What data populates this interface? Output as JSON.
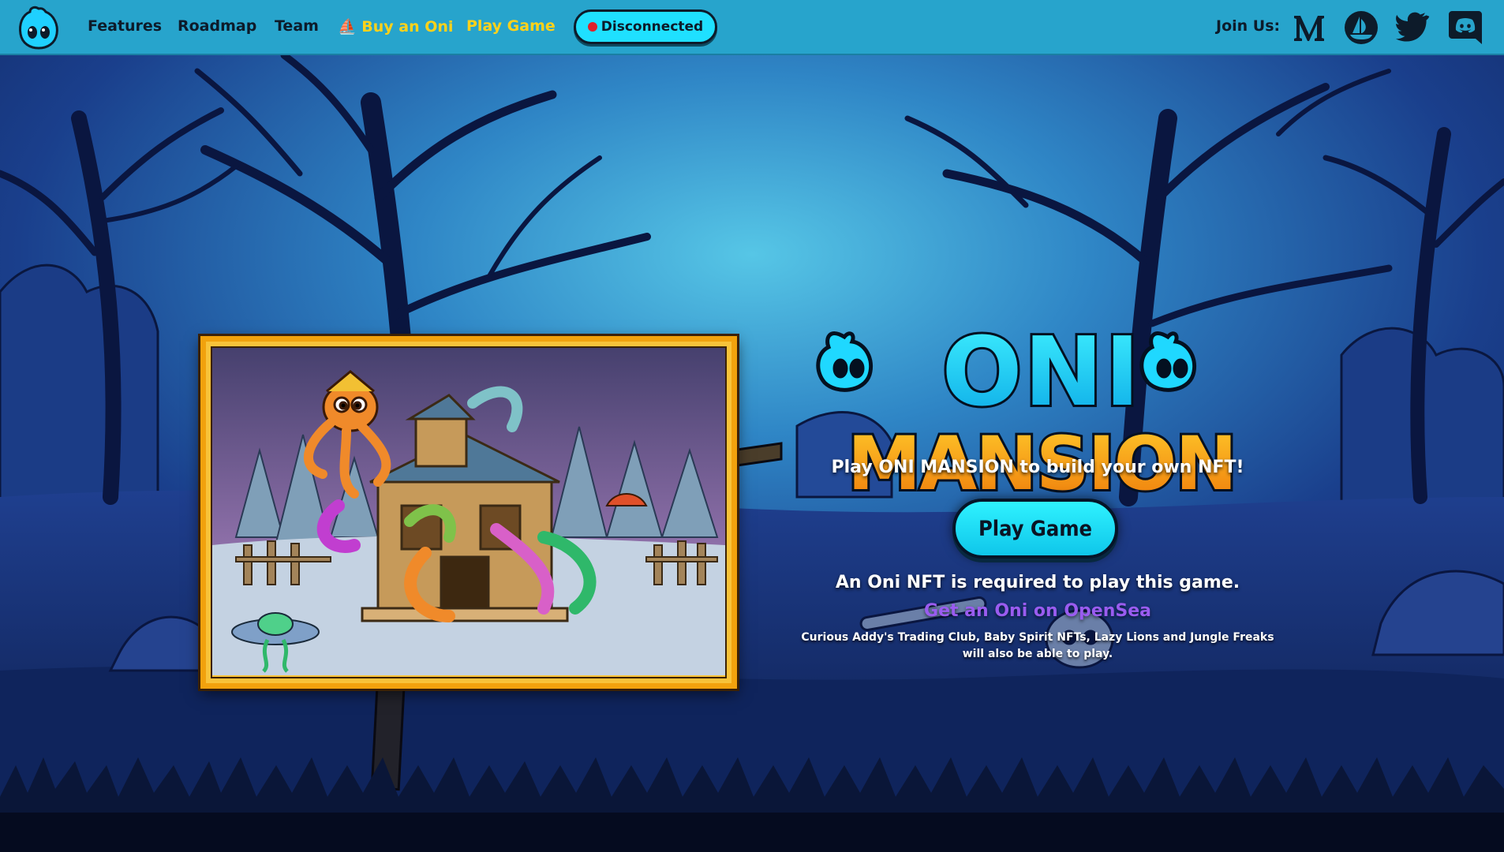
{
  "nav": {
    "links": [
      {
        "label": "Features"
      },
      {
        "label": "Roadmap"
      },
      {
        "label": "Team"
      },
      {
        "label": "⛵ Buy an Oni"
      },
      {
        "label": "Play Game"
      }
    ],
    "status_label": "Disconnected",
    "join_label": "Join Us:",
    "socials": [
      "medium-icon",
      "opensea-icon",
      "twitter-icon",
      "discord-icon"
    ]
  },
  "hero": {
    "title_line1": "ONI",
    "title_line2": "MANSION",
    "tagline": "Play ONI MANSION to build your own NFT!",
    "play_button": "Play Game",
    "required_text": "An Oni NFT is required to play this game.",
    "opensea_link": "Get an Oni on OpenSea",
    "partners_text": "Curious Addy's Trading Club, Baby Spirit NFTs, Lazy Lions and Jungle Freaks will also be able to play."
  },
  "colors": {
    "nav_bg": "#27a4cc",
    "accent_cyan": "#1fe0ff",
    "accent_yellow": "#ffd21a",
    "link_purple": "#9a5cf0",
    "title_orange": "#f49a16",
    "status_red": "#e0202a"
  }
}
